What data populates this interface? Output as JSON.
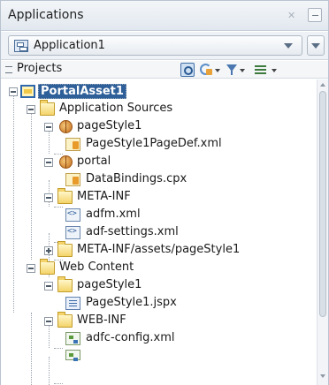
{
  "window": {
    "title": "Applications"
  },
  "app_selector": {
    "selected": "Application1"
  },
  "projects_bar": {
    "label": "Projects"
  },
  "tree": {
    "root": "PortalAsset1",
    "application_sources": "Application Sources",
    "pagestyle_pkg": "pageStyle1",
    "pagestyle_pagedef": "PageStyle1PageDef.xml",
    "portal_pkg": "portal",
    "databindings": "DataBindings.cpx",
    "meta_inf": "META-INF",
    "adfm": "adfm.xml",
    "adf_settings": "adf-settings.xml",
    "meta_inf_assets": "META-INF/assets/pageStyle1",
    "web_content": "Web Content",
    "web_pagestyle": "pageStyle1",
    "pagestyle_jspx": "PageStyle1.jspx",
    "web_inf": "WEB-INF",
    "adfc_config": "adfc-config.xml"
  },
  "colors": {
    "selection": "#2e5f99",
    "folder": "#f4d46a"
  }
}
